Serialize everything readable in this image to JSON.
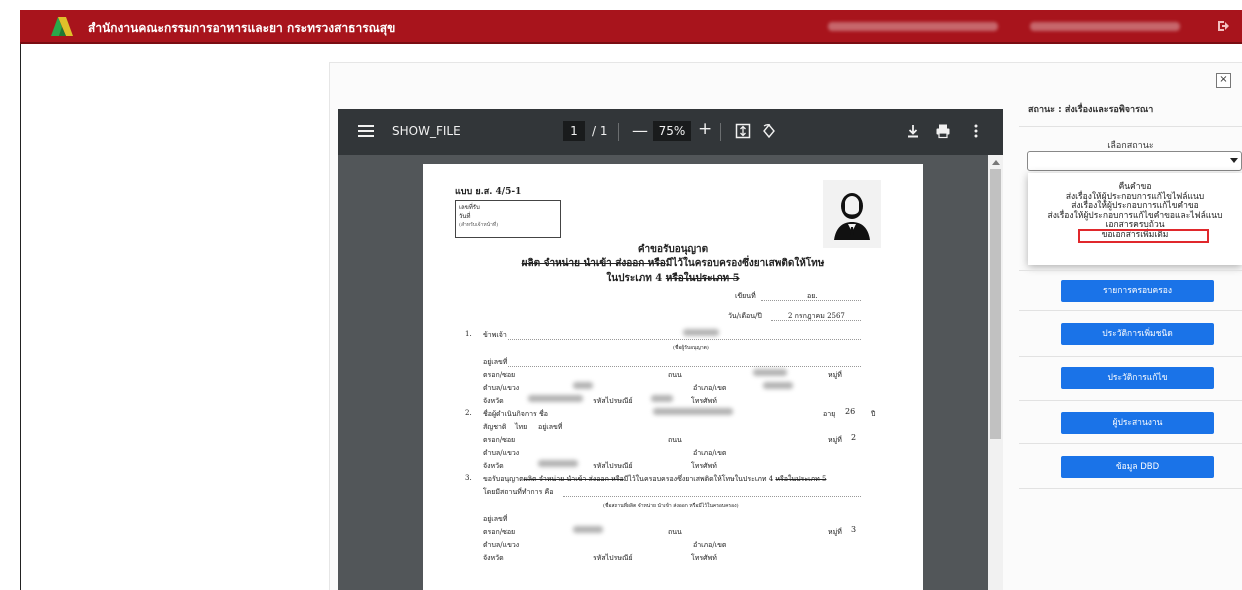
{
  "header": {
    "brand": "สำนักงานคณะกรรมการอาหารและยา กระทรวงสาธารณสุข",
    "colors": {
      "bar": "#a8141c"
    }
  },
  "modal": {
    "close_label": "×"
  },
  "viewer": {
    "title": "SHOW_FILE",
    "page_current": "1",
    "page_total": "/ 1",
    "zoom": "75%",
    "minus": "—",
    "plus": "+",
    "icons": [
      "menu-icon",
      "fit-page-icon",
      "rotate-icon",
      "download-icon",
      "print-icon",
      "more-icon"
    ]
  },
  "document": {
    "form_code": "แบบ ย.ส. 4/5-1",
    "recv_no": "เลขที่รับ",
    "recv_date": "วันที่",
    "recv_note": "(สำหรับเจ้าหน้าที่)",
    "title1": "คำขอรับอนุญาต",
    "title2_strike": "ผลิต จำหน่าย นำเข้า ส่งออก หรือ",
    "title2_rest": "มีไว้ในครอบครองซึ่งยาเสพติดให้โทษ",
    "title3": "ในประเภท 4",
    "title3_strike": "หรือในประเภท 5",
    "written_at": "เขียนที่",
    "written_at_value": "อย.",
    "date_label": "วัน/เดือน/ปี",
    "date_value": "2 กรกฎาคม  2567",
    "item1_no": "1.",
    "item1_label": "ข้าพเจ้า",
    "item1_note": "(ชื่อผู้รับอนุญาต)",
    "addr_no": "อยู่เลขที่",
    "alley": "ตรอก/ซอย",
    "road": "ถนน",
    "moo": "หมู่ที่",
    "subdistrict": "ตำบล/แขวง",
    "district": "อำเภอ/เขต",
    "province": "จังหวัด",
    "postcode": "รหัสไปรษณีย์",
    "phone": "โทรศัพท์",
    "item2_no": "2.",
    "item2_label": "ชื่อผู้ดำเนินกิจการ ชื่อ",
    "age_label": "อายุ",
    "age_value": "26",
    "age_unit": "ปี",
    "nationality": "สัญชาติ",
    "nationality_value": "ไทย",
    "moo2_value": "2",
    "item3_no": "3.",
    "item3_text": "ขอรับอนุญาต",
    "item3_strike": "ผลิต จำหน่าย นำเข้า ส่งออก หรือ",
    "item3_rest": "มีไว้ในครอบครองซึ่งยาเสพติดให้โทษในประเภท 4",
    "item3_strike2": "หรือในประเภท 5",
    "item3_place": "โดยมีสถานที่ทำการ คือ",
    "item3_note": "(ชื่อสถานที่ผลิต จำหน่าย นำเข้า ส่งออก หรือมีไว้ในครอบครอง)",
    "moo3_value": "3"
  },
  "sidebar": {
    "status_text": "สถานะ : ส่งเรื่องและรอพิจารณา",
    "select_label": "เลือกสถานะ",
    "options": [
      "คืนคำขอ",
      "ส่งเรื่องให้ผู้ประกอบการแก้ไขไฟล์แนบ",
      "ส่งเรื่องให้ผู้ประกอบการแก้ไขคำขอ",
      "ส่งเรื่องให้ผู้ประกอบการแก้ไขคำขอและไฟล์แนบ",
      "เอกสารครบถ้วน",
      "ขอเอกสารเพิ่มเติม"
    ],
    "buttons": [
      "รายการครอบครอง",
      "ประวัติการเพิ่มชนิด",
      "ประวัติการแก้ไข",
      "ผู้ประสานงาน",
      "ข้อมูล DBD"
    ],
    "colors": {
      "button": "#1a73e8",
      "highlight": "#e0282c"
    }
  }
}
